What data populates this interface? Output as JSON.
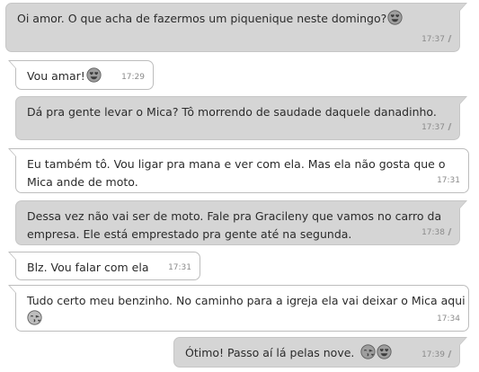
{
  "conversation": {
    "messages": [
      {
        "direction": "out",
        "lines": [
          "Oi amor. O que acha de fazermos um piquenique neste domingo?"
        ],
        "emoji": "heart-eyes-emoji",
        "time": "17:37",
        "read": true
      },
      {
        "direction": "in",
        "lines": [
          "Vou amar!"
        ],
        "emoji": "heart-eyes-emoji",
        "time": "17:29"
      },
      {
        "direction": "out",
        "lines": [
          "Dá pra gente levar o Mica? Tô morrendo de saudade daquele danadinho."
        ],
        "time": "17:37",
        "read": true
      },
      {
        "direction": "in",
        "lines": [
          "Eu também tô. Vou ligar pra mana e ver com ela. Mas ela não gosta que o",
          "Mica ande de moto."
        ],
        "time": "17:31"
      },
      {
        "direction": "out",
        "lines": [
          "Dessa vez não vai ser de moto. Fale pra Gracileny que vamos no carro da",
          "empresa. Ele está emprestado pra gente até na segunda."
        ],
        "time": "17:38",
        "read": true
      },
      {
        "direction": "in",
        "lines": [
          "Blz. Vou falar com ela"
        ],
        "time": "17:31"
      },
      {
        "direction": "in",
        "lines": [
          "Tudo certo meu benzinho. No caminho para a igreja ela vai deixar o Mica aqui"
        ],
        "emoji": "kissing-emoji",
        "time": "17:34"
      },
      {
        "direction": "out",
        "lines": [
          "Ótimo! Passo aí lá pelas nove."
        ],
        "emoji": "kissing-and-heart-eyes-emoji",
        "time": "17:39",
        "read": true
      }
    ]
  },
  "colors": {
    "outgoing_bubble": "#d5d5d5",
    "incoming_bubble": "#ffffff",
    "timestamp": "#8a8a8a"
  }
}
